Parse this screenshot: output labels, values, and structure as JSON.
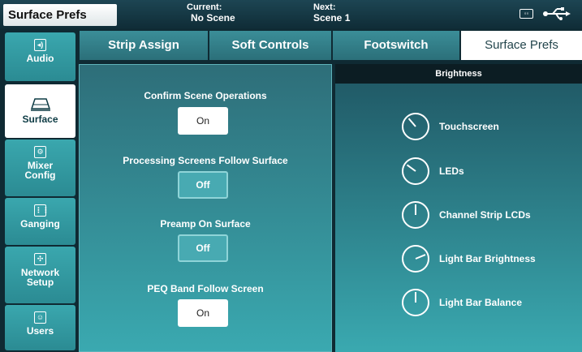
{
  "header": {
    "title": "Surface Prefs",
    "current_label": "Current:",
    "current_value": "No Scene",
    "next_label": "Next:",
    "next_value": "Scene 1",
    "icons": [
      "meter-icon",
      "usb-icon"
    ]
  },
  "sidebar": {
    "items": [
      {
        "label": "Audio",
        "icon": "audio-icon",
        "active": false
      },
      {
        "label": "Surface",
        "icon": "surface-icon",
        "active": true
      },
      {
        "label": "Mixer Config",
        "icon": "mixer-config-icon",
        "active": false
      },
      {
        "label": "Ganging",
        "icon": "ganging-icon",
        "active": false
      },
      {
        "label": "Network Setup",
        "icon": "network-icon",
        "active": false
      },
      {
        "label": "Users",
        "icon": "users-icon",
        "active": false
      }
    ]
  },
  "tabs": [
    {
      "label": "Strip Assign",
      "active": false
    },
    {
      "label": "Soft Controls",
      "active": false
    },
    {
      "label": "Footswitch",
      "active": false
    },
    {
      "label": "Surface Prefs",
      "active": true
    }
  ],
  "options": [
    {
      "label": "Confirm Scene Operations",
      "value": "On"
    },
    {
      "label": "Processing Screens Follow Surface",
      "value": "Off"
    },
    {
      "label": "Preamp On Surface",
      "value": "Off"
    },
    {
      "label": "PEQ Band Follow Screen",
      "value": "On"
    }
  ],
  "brightness": {
    "title": "Brightness",
    "knobs": [
      {
        "label": "Touchscreen",
        "level": 0.35
      },
      {
        "label": "LEDs",
        "level": 0.3
      },
      {
        "label": "Channel Strip LCDs",
        "level": 0.5
      },
      {
        "label": "Light Bar Brightness",
        "level": 0.75
      },
      {
        "label": "Light Bar Balance",
        "level": 0.5
      }
    ]
  },
  "colors": {
    "accent": "#3aa7ae",
    "dark": "#0f2a33",
    "active_tab": "#ffffff"
  }
}
